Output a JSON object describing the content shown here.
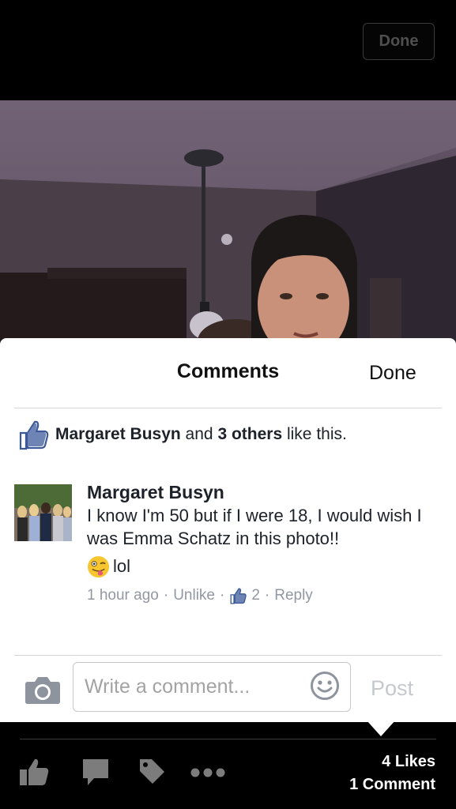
{
  "header": {
    "done_label": "Done"
  },
  "sheet": {
    "title": "Comments",
    "done_label": "Done",
    "likes": {
      "name": "Margaret Busyn",
      "connector": " and ",
      "others": "3 others",
      "suffix": " like this."
    },
    "comments": [
      {
        "author": "Margaret Busyn",
        "text": "I know I'm 50 but if I were 18, I would wish I was Emma Schatz in this photo!!",
        "extra": "lol",
        "time": "1 hour ago",
        "unlike_label": "Unlike",
        "like_count": "2",
        "reply_label": "Reply"
      }
    ],
    "composer": {
      "placeholder": "Write a comment...",
      "post_label": "Post"
    }
  },
  "footer": {
    "likes_count": "4 Likes",
    "comments_count": "1 Comment"
  },
  "icons": {
    "top": "none",
    "likes_row": "like-thumb-icon",
    "composer": [
      "camera-icon",
      "smiley-icon"
    ],
    "footer": [
      "like-icon",
      "comment-icon",
      "tag-icon",
      "more-icon"
    ]
  },
  "colors": {
    "brand_blue": "#3b5998",
    "muted_text": "#9197a3",
    "primary_text": "#1d2129"
  }
}
